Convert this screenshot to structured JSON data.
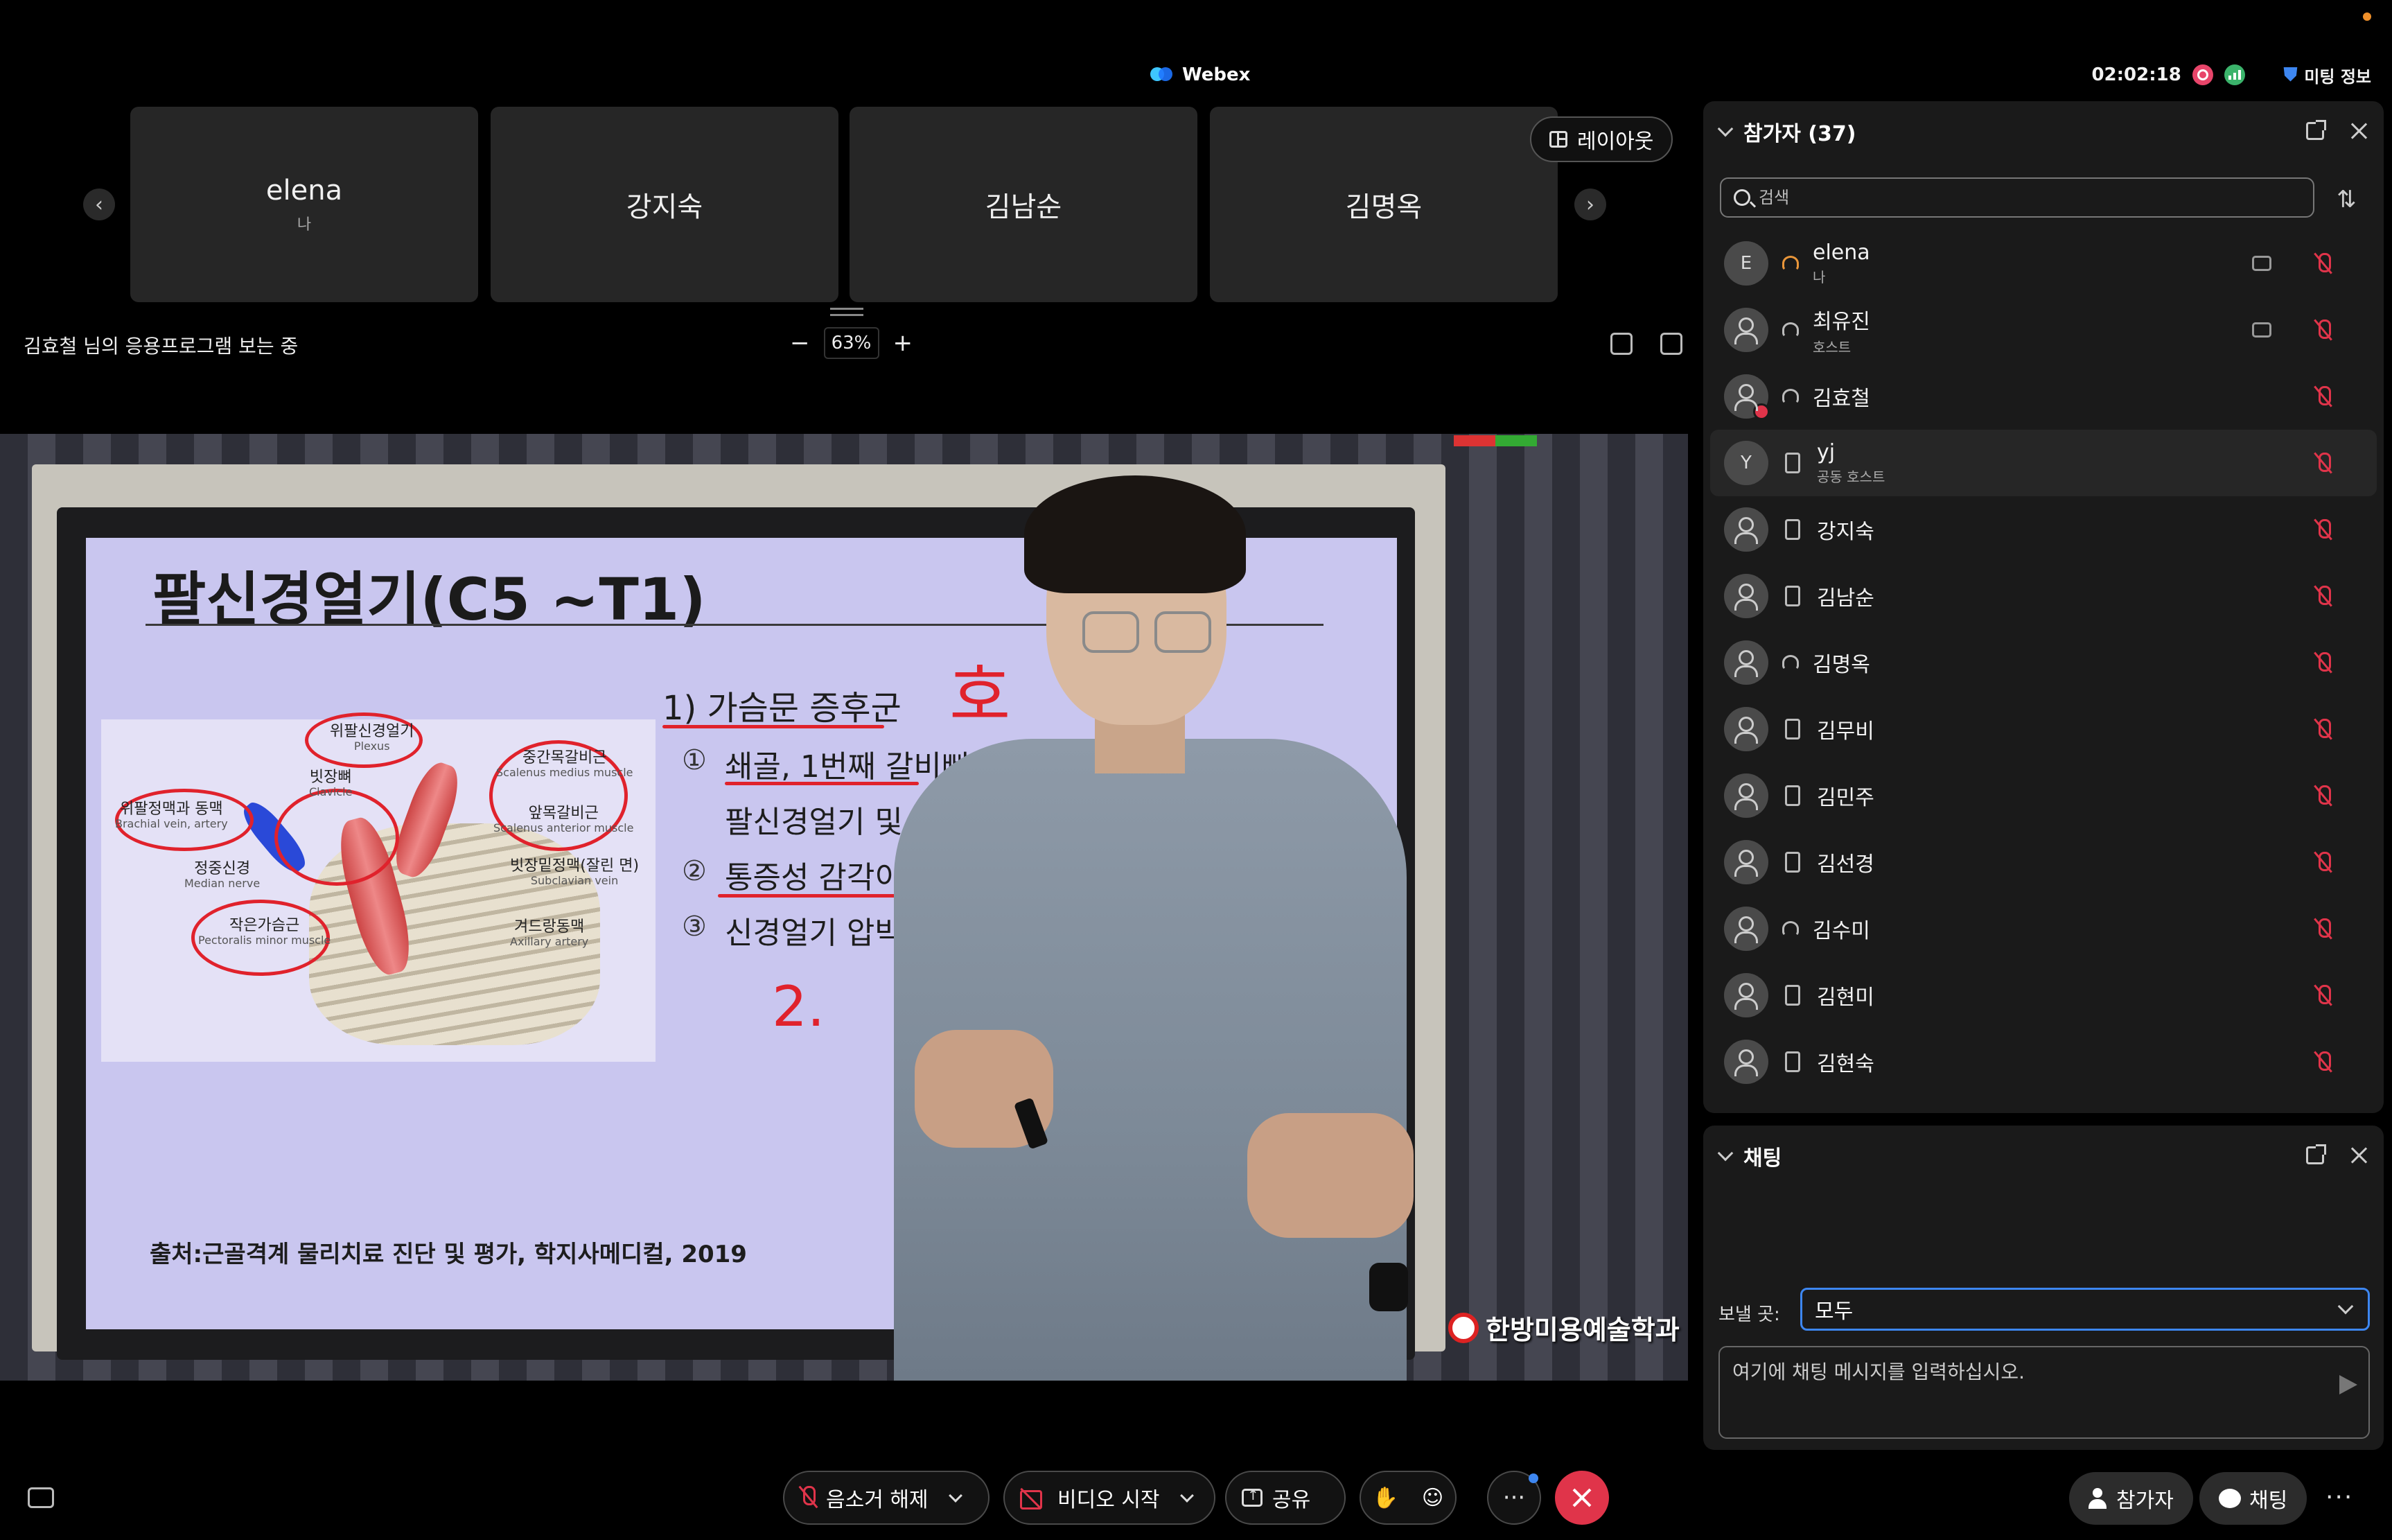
{
  "app": {
    "title": "Webex"
  },
  "top_bar": {
    "clock": "02:02:18",
    "meeting_info": "미팅 정보"
  },
  "thumbnails": [
    {
      "name": "elena",
      "sub": "나"
    },
    {
      "name": "강지숙",
      "sub": ""
    },
    {
      "name": "김남순",
      "sub": ""
    },
    {
      "name": "김명옥",
      "sub": ""
    }
  ],
  "layout_button": {
    "label": "레이아웃"
  },
  "share_bar": {
    "status": "김효철 님의 응용프로그램 보는 중",
    "zoom": "63%",
    "zoom_out": "−",
    "zoom_in": "+"
  },
  "slide": {
    "title": "팔신경얼기(C5 ~T1)",
    "heading": "1) 가슴문 증후군",
    "item1_num": "①",
    "item1": "쇄골, 1번째 갈비뼈 에 있는 공간에",
    "item1_cont": "팔신경얼기 및 동맥 압박",
    "item2_num": "②",
    "item2": "통증성 감각이상",
    "item3_num": "③",
    "item3": "신경얼기 압박 시",
    "handwriting_num": "2.",
    "handwriting_word": "호",
    "labels": {
      "brachial_plexus": "위팔신경얼기",
      "brachial_plexus_en": "Plexus",
      "clavicle": "빗장뼈",
      "clavicle_en": "Clavicle",
      "brachial_vein": "위팔정맥과 동맥",
      "brachial_vein_en": "Brachial vein, artery",
      "median_nerve": "정중신경",
      "median_nerve_en": "Median nerve",
      "pec_minor": "작은가슴근",
      "pec_minor_en": "Pectoralis minor muscle",
      "scalene_medius": "중간목갈비근",
      "scalene_medius_en": "Scalenus medius muscle",
      "scalene_anterior": "앞목갈비근",
      "scalene_anterior_en": "Scalenus anterior muscle",
      "subclavian_vein": "빗장밑정맥(잘린 면)",
      "subclavian_vein_en": "Subclavian vein",
      "axillary_artery": "겨드랑동맥",
      "axillary_artery_en": "Axillary artery"
    },
    "source": "출처:근골격계 물리치료 진단 및 평가, 학지사메디컬, 2019",
    "watermark": "한방미용예술학과"
  },
  "participants": {
    "title": "참가자 (37)",
    "search_placeholder": "검색",
    "list": [
      {
        "initial": "E",
        "name": "elena",
        "role": "나",
        "device": "headset-orange",
        "cc": true
      },
      {
        "initial": "",
        "name": "최유진",
        "role": "호스트",
        "device": "headset",
        "cc": true
      },
      {
        "initial": "",
        "name": "김효철",
        "role": "",
        "device": "headset",
        "badge": true
      },
      {
        "initial": "Y",
        "name": "yj",
        "role": "공동 호스트",
        "device": "phone",
        "highlight": true
      },
      {
        "initial": "",
        "name": "강지숙",
        "role": "",
        "device": "phone"
      },
      {
        "initial": "",
        "name": "김남순",
        "role": "",
        "device": "phone"
      },
      {
        "initial": "",
        "name": "김명옥",
        "role": "",
        "device": "headset"
      },
      {
        "initial": "",
        "name": "김무비",
        "role": "",
        "device": "phone"
      },
      {
        "initial": "",
        "name": "김민주",
        "role": "",
        "device": "phone"
      },
      {
        "initial": "",
        "name": "김선경",
        "role": "",
        "device": "phone"
      },
      {
        "initial": "",
        "name": "김수미",
        "role": "",
        "device": "headset"
      },
      {
        "initial": "",
        "name": "김현미",
        "role": "",
        "device": "phone"
      },
      {
        "initial": "",
        "name": "김현숙",
        "role": "",
        "device": "phone"
      }
    ]
  },
  "chat": {
    "title": "채팅",
    "send_to_label": "보낼 곳:",
    "send_to_value": "모두",
    "input_placeholder": "여기에 채팅 메시지를 입력하십시오."
  },
  "controls": {
    "mute": "음소거 해제",
    "video": "비디오 시작",
    "share": "공유",
    "participants": "참가자",
    "chat": "채팅",
    "more": "···"
  },
  "colors": {
    "accent": "#3d86f0",
    "danger": "#e0344a",
    "panel_bg": "#1a1a1a"
  }
}
